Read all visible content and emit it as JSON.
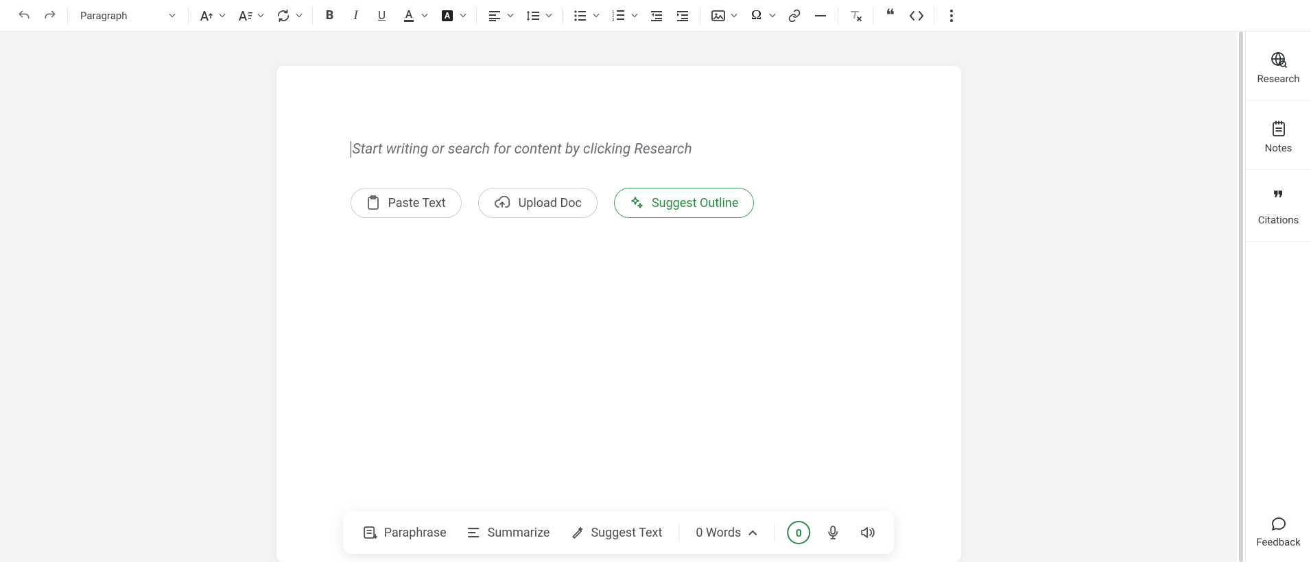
{
  "toolbar": {
    "block_format": "Paragraph"
  },
  "editor": {
    "placeholder": "Start writing or search for content by clicking Research",
    "chips": {
      "paste": "Paste Text",
      "upload": "Upload Doc",
      "suggest": "Suggest Outline"
    }
  },
  "floatbar": {
    "paraphrase": "Paraphrase",
    "summarize": "Summarize",
    "suggest_text": "Suggest Text",
    "word_count_label": "0 Words",
    "badge_value": "0"
  },
  "right_panel": {
    "research": "Research",
    "notes": "Notes",
    "citations": "Citations",
    "feedback": "Feedback"
  }
}
